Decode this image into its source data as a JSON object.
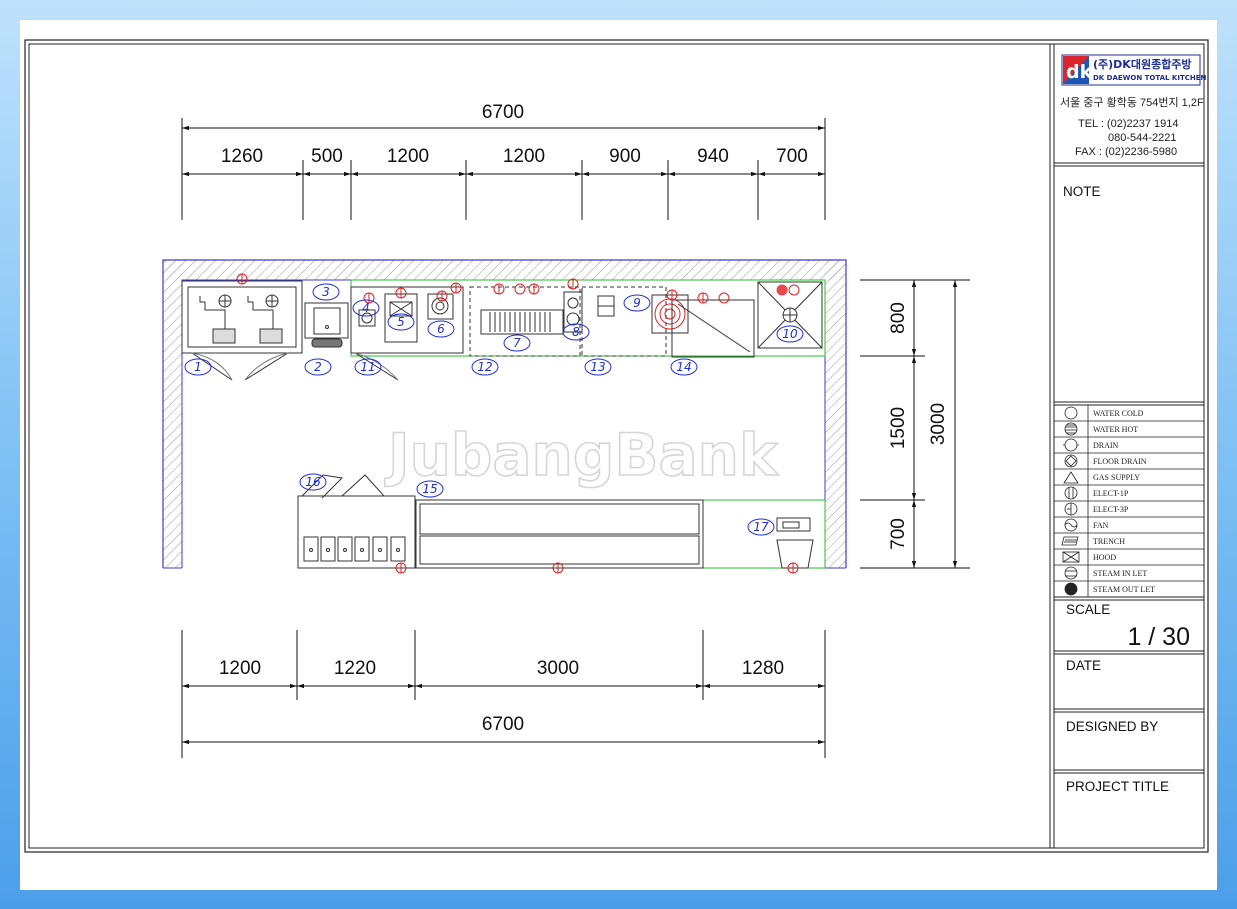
{
  "dimensions": {
    "top_total": "6700",
    "top_segments": [
      "1260",
      "500",
      "1200",
      "1200",
      "900",
      "940",
      "700"
    ],
    "bottom_segments": [
      "1200",
      "1220",
      "3000",
      "1280"
    ],
    "bottom_total": "6700",
    "right_segments": [
      "800",
      "1500",
      "700"
    ],
    "right_total": "3000"
  },
  "equipment_tags": [
    "1",
    "2",
    "3",
    "4",
    "5",
    "6",
    "7",
    "8",
    "9",
    "10",
    "11",
    "12",
    "13",
    "14",
    "15",
    "16",
    "17"
  ],
  "watermark": "JubangBank",
  "title_block": {
    "company_kr": "(주)DK대원종합주방",
    "company_en": "DK DAEWON TOTAL KITCHEN",
    "logo_mark": "dk",
    "address": "서울 중구 황학동 754번지 1,2F",
    "tel": "TEL : (02)2237 1914",
    "tel2": "080-544-2221",
    "fax": "FAX : (02)2236-5980",
    "note_label": "NOTE",
    "scale_label": "SCALE",
    "scale_value": "1 / 30",
    "date_label": "DATE",
    "designed_by_label": "DESIGNED BY",
    "project_title_label": "PROJECT TITLE"
  },
  "legend": [
    {
      "icon": "water-cold-icon",
      "label": "WATER COLD"
    },
    {
      "icon": "water-hot-icon",
      "label": "WATER HOT"
    },
    {
      "icon": "drain-icon",
      "label": "DRAIN"
    },
    {
      "icon": "floor-drain-icon",
      "label": "FLOOR DRAIN"
    },
    {
      "icon": "gas-supply-icon",
      "label": "GAS SUPPLY"
    },
    {
      "icon": "elect-1p-icon",
      "label": "ELECT-1P"
    },
    {
      "icon": "elect-3p-icon",
      "label": "ELECT-3P"
    },
    {
      "icon": "fan-icon",
      "label": "FAN"
    },
    {
      "icon": "trench-icon",
      "label": "TRENCH"
    },
    {
      "icon": "hood-icon",
      "label": "HOOD"
    },
    {
      "icon": "steam-in-let-icon",
      "label": "STEAM IN LET"
    },
    {
      "icon": "steam-out-let-icon",
      "label": "STEAM OUT LET"
    }
  ],
  "colors": {
    "wall": "#3b3bd6",
    "equipment_outline": "#22c12a",
    "utility_marker": "#e02020",
    "tag": "#1f2fd6",
    "logo_red": "#d8262c",
    "logo_blue": "#1e56b8"
  }
}
